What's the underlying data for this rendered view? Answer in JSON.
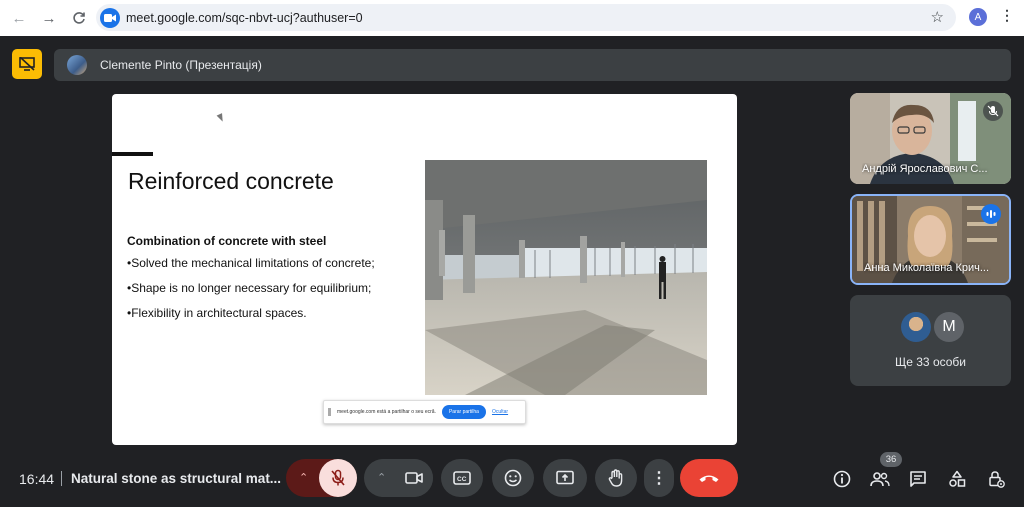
{
  "browser": {
    "url": "meet.google.com/sqc-nbvt-ucj?authuser=0",
    "profile_initial": "A"
  },
  "presenter": {
    "name": "Clemente Pinto (Презентація)"
  },
  "slide": {
    "title": "Reinforced concrete",
    "subtitle": "Combination of concrete with steel",
    "bullets": [
      "•Solved the mechanical limitations of concrete;",
      "•Shape is no longer necessary for equilibrium;",
      "•Flexibility in architectural spaces."
    ],
    "share_notice": {
      "text": "meet.google.com está a partilhar o seu ecrã.",
      "stop_label": "Parar partilha",
      "hide_label": "Ocultar"
    }
  },
  "participants": [
    {
      "name": "Андрій Ярославович С...",
      "muted": true,
      "speaking": false
    },
    {
      "name": "Анна Миколаївна Крич...",
      "muted": false,
      "speaking": true
    }
  ],
  "more_participants": {
    "letter_avatar": "M",
    "label": "Ще 33 особи"
  },
  "bottom_bar": {
    "time": "16:44",
    "meeting_title": "Natural stone as structural mat...",
    "people_count": "36"
  },
  "colors": {
    "background": "#202124",
    "present_toggle": "#fbbc04",
    "end_call": "#ea4335",
    "mic_off": "#f9dedc",
    "accent": "#1a73e8"
  },
  "icons": {
    "back": "arrow-left-icon",
    "forward": "arrow-right-icon",
    "reload": "reload-icon",
    "bookmark": "star-icon",
    "mic": "mic-off-icon",
    "camera": "camera-icon",
    "captions": "captions-icon",
    "emoji": "emoji-icon",
    "present": "present-icon",
    "hand": "raise-hand-icon",
    "more": "more-options-icon",
    "end": "end-call-icon",
    "info": "info-icon",
    "people": "people-icon",
    "chat": "chat-icon",
    "activities": "activities-icon",
    "host": "host-controls-icon"
  }
}
